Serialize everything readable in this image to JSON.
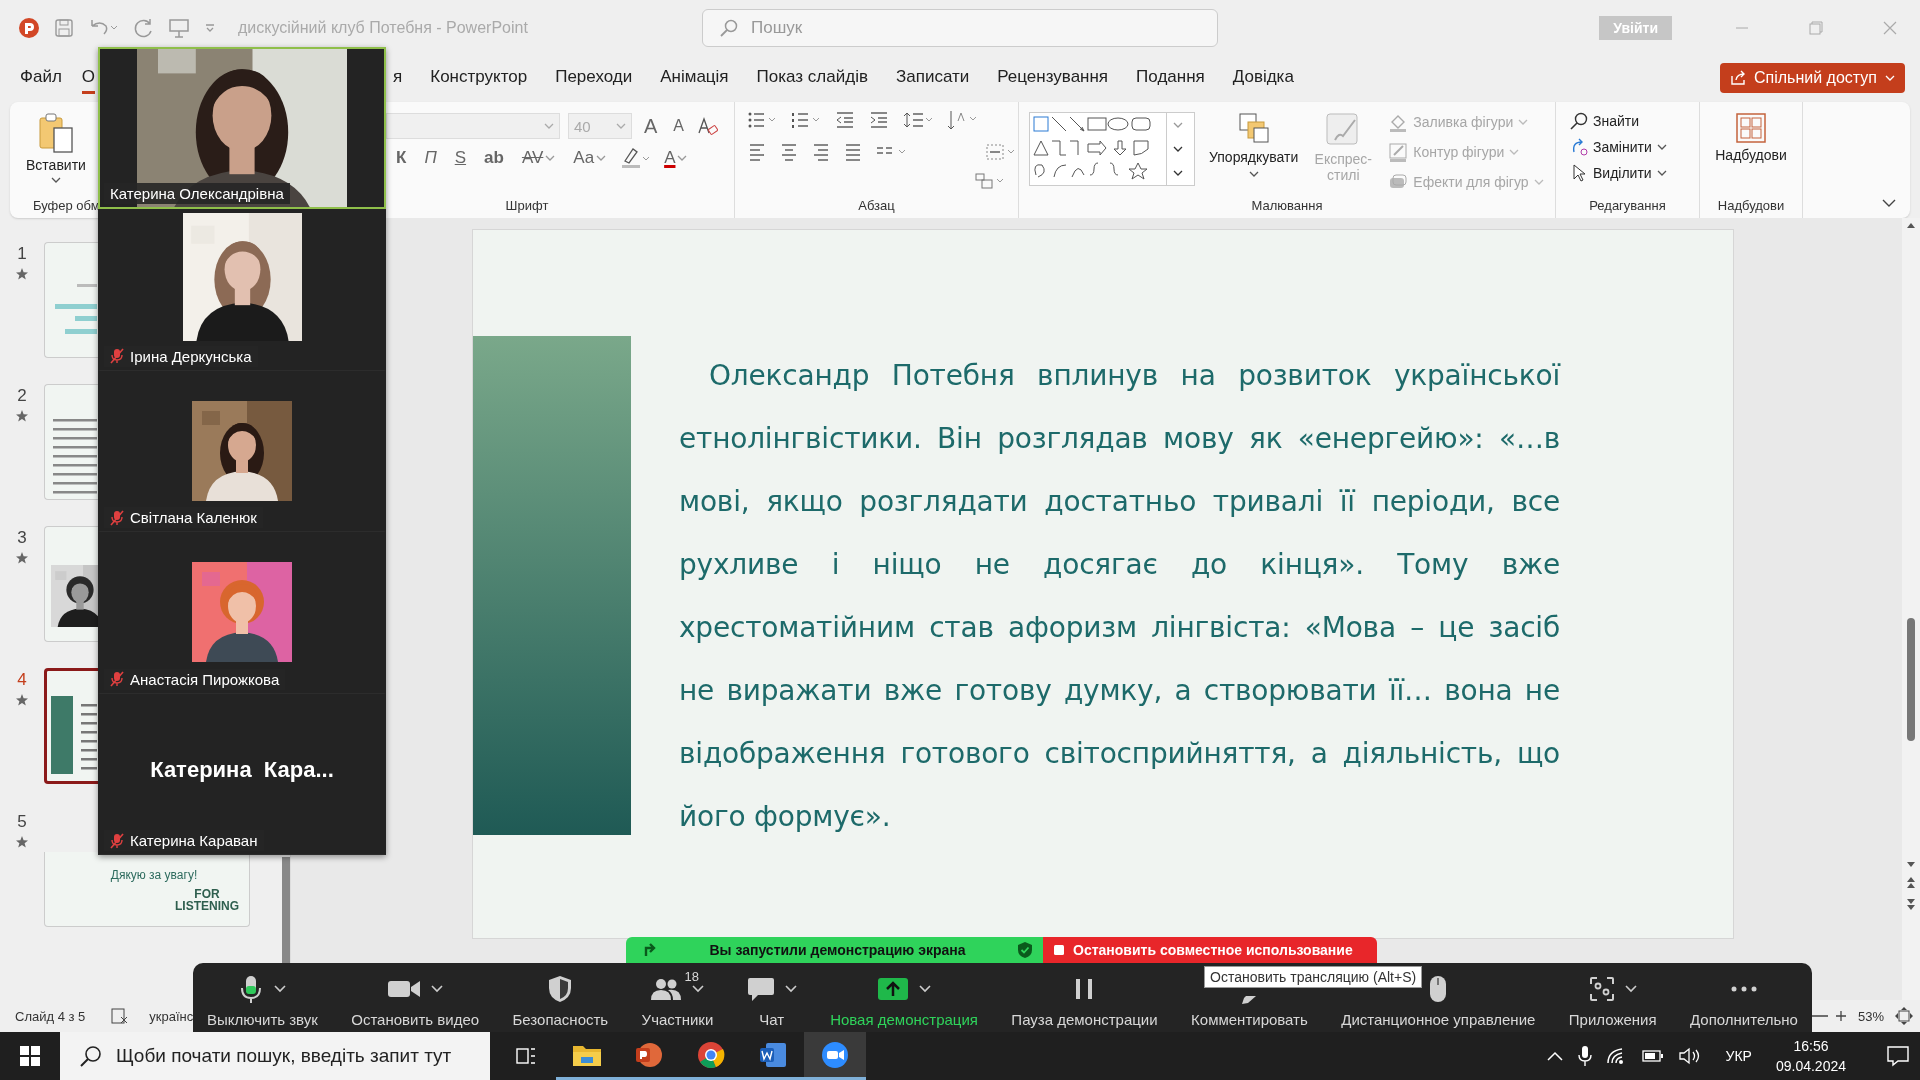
{
  "title_bar": {
    "document_title": "дискусійний клуб Потебня  -  PowerPoint",
    "search": {
      "placeholder": "Пошук"
    },
    "sign_in": "Увійти"
  },
  "menu_tabs": [
    {
      "label": "Файл",
      "selected": false
    },
    {
      "label": "О",
      "selected": true
    },
    {
      "label": "я",
      "selected": false
    },
    {
      "label": "Конструктор",
      "selected": false
    },
    {
      "label": "Переходи",
      "selected": false
    },
    {
      "label": "Анімація",
      "selected": false
    },
    {
      "label": "Показ слайдів",
      "selected": false
    },
    {
      "label": "Записати",
      "selected": false
    },
    {
      "label": "Рецензування",
      "selected": false
    },
    {
      "label": "Подання",
      "selected": false
    },
    {
      "label": "Довідка",
      "selected": false
    }
  ],
  "share_button": "Спільний доступ",
  "ribbon": {
    "clipboard": {
      "paste": "Вставити",
      "label": "Буфер обм"
    },
    "font": {
      "size": "40",
      "size_buttons": [
        "A",
        "A"
      ],
      "style_buttons": [
        "К",
        "П",
        "S",
        "ab",
        "AV",
        "Aa"
      ],
      "color_letter": "A",
      "label": "Шрифт"
    },
    "paragraph": {
      "label": "Абзац"
    },
    "drawing": {
      "arrange": {
        "label": "Упорядкувати",
        "disabled": false
      },
      "quick_styles": {
        "label": "Експрес-стилі",
        "disabled": true
      },
      "shape_format": [
        {
          "label": "Заливка фігури",
          "kind": "fill",
          "disabled": true
        },
        {
          "label": "Контур фігури",
          "kind": "outline",
          "disabled": true
        },
        {
          "label": "Ефекти для фігур",
          "kind": "effects",
          "disabled": true
        }
      ],
      "label": "Малювання"
    },
    "editing": {
      "find": "Знайти",
      "replace": "Замінити",
      "select": "Виділити",
      "label": "Редагування"
    },
    "addins": {
      "button": "Надбудови",
      "label": "Надбудови"
    }
  },
  "slides": [
    {
      "number": "1",
      "kind": "title",
      "selected": false
    },
    {
      "number": "2",
      "kind": "text",
      "selected": false
    },
    {
      "number": "3",
      "kind": "portrait",
      "selected": false
    },
    {
      "number": "4",
      "kind": "quote",
      "selected": true
    },
    {
      "number": "5",
      "kind": "thanks",
      "selected": false,
      "texts": [
        "Дякую за увагу!",
        "FOR LISTENING"
      ]
    }
  ],
  "slide": {
    "paragraph": "Олександр Потебня вплинув на розвиток української етнолінгвістики. Він розглядав мову як «енергейю»: «…в мові, якщо розглядати достатньо тривалі її періоди, все рухливе і ніщо не досягає до кінця». Тому вже хрестоматійним став афоризм лінгвіста: «Мова – це засіб не виражати вже готову думку, а створювати її… вона не відображення готового світосприйняття, а діяльність, що його формує»."
  },
  "status_bar": {
    "slide_counter": "Слайд 4 з 5",
    "language": "українс",
    "zoom": "53%"
  },
  "meeting_panel": {
    "participants": [
      {
        "name": "Катерина Олександрівна",
        "kind": "video",
        "muted": false,
        "speaking": true
      },
      {
        "name": "Ірина Деркунська",
        "kind": "video",
        "muted": true,
        "speaking": false
      },
      {
        "name": "Світлана Каленюк",
        "kind": "video",
        "muted": true,
        "speaking": false
      },
      {
        "name": "Анастасія Пирожкова",
        "kind": "video",
        "muted": true,
        "speaking": false
      },
      {
        "name": "Катерина Караван",
        "display_name": "Катерина  Кара...",
        "kind": "name_only",
        "muted": true,
        "speaking": false
      }
    ]
  },
  "share_banner": {
    "status": "Вы запустили демонстрацию экрана",
    "stop": "Остановить совместное использование"
  },
  "meeting_toolbar": {
    "items": [
      {
        "label": "Выключить звук",
        "kind": "mic",
        "caret": true,
        "highlighted": false
      },
      {
        "label": "Остановить видео",
        "kind": "video",
        "caret": true,
        "highlighted": false
      },
      {
        "label": "Безопасность",
        "kind": "security",
        "caret": false,
        "highlighted": false
      },
      {
        "label": "Участники",
        "kind": "participants",
        "caret": true,
        "highlighted": false,
        "count": "18"
      },
      {
        "label": "Чат",
        "kind": "chat",
        "caret": true,
        "highlighted": false
      },
      {
        "label": "Новая демонстрация",
        "kind": "share",
        "caret": true,
        "highlighted": true
      },
      {
        "label": "Пауза демонстрации",
        "kind": "pause",
        "caret": false,
        "highlighted": false
      },
      {
        "label": "Комментировать",
        "kind": "annotate",
        "caret": false,
        "highlighted": false
      },
      {
        "label": "Дистанционное управление",
        "kind": "remote",
        "caret": false,
        "highlighted": false
      },
      {
        "label": "Приложения",
        "kind": "apps",
        "caret": true,
        "highlighted": false
      },
      {
        "label": "Дополнительно",
        "kind": "more",
        "caret": false,
        "highlighted": false
      }
    ]
  },
  "tooltip": "Остановить трансляцию (Alt+S)",
  "taskbar": {
    "search": {
      "placeholder": "Щоби почати пошук, введіть запит тут"
    },
    "apps": [
      {
        "kind": "folder",
        "selected": false
      },
      {
        "kind": "presentation",
        "selected": false
      },
      {
        "kind": "browser",
        "selected": false
      },
      {
        "kind": "document",
        "selected": false
      },
      {
        "kind": "video_call",
        "selected": true
      }
    ],
    "language": "УКР",
    "time": "16:56",
    "date": "09.04.2024"
  }
}
